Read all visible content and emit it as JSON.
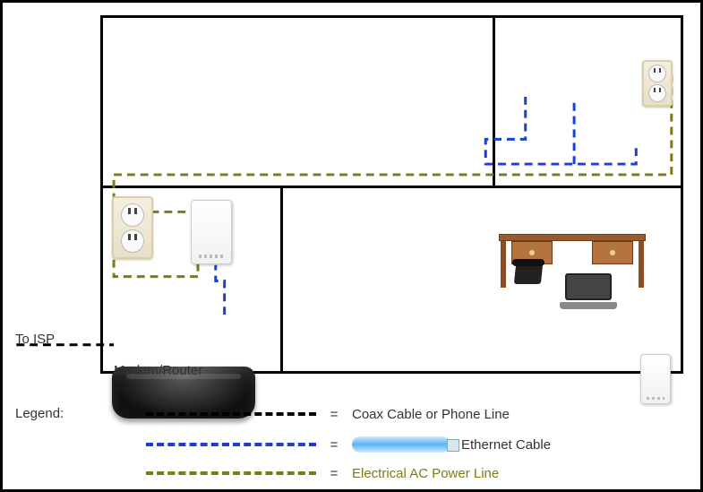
{
  "labels": {
    "to_isp": "To ISP",
    "modem_router": "Modem/Router",
    "legend_title": "Legend:"
  },
  "legend": {
    "rows": [
      {
        "eq": "=",
        "text": "Coax Cable or Phone Line"
      },
      {
        "eq": "=",
        "text": "Ethernet Cable"
      },
      {
        "eq": "=",
        "text": "Electrical AC Power Line"
      }
    ]
  },
  "connections": {
    "coax_phone": {
      "color": "#000000",
      "style": "dashed",
      "label": "Coax Cable or Phone Line"
    },
    "ethernet": {
      "color": "#1a3fd6",
      "style": "dashed",
      "label": "Ethernet Cable"
    },
    "ac_power": {
      "color": "#7f7a18",
      "style": "dashed",
      "label": "Electrical AC Power Line"
    }
  },
  "devices": {
    "room_lower_left": [
      "wall-outlet",
      "powerline-adapter",
      "modem-router"
    ],
    "room_upper_right": [
      "desk",
      "ip-phone",
      "laptop",
      "wall-outlet",
      "powerline-adapter"
    ]
  }
}
